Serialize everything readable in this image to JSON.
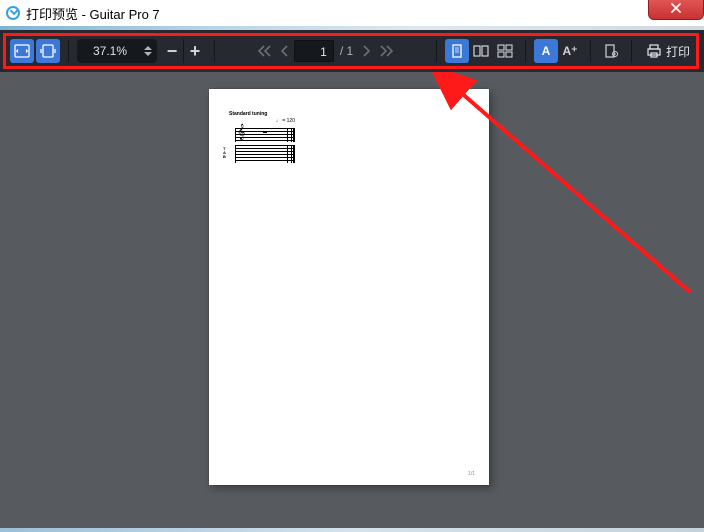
{
  "window": {
    "title": "打印预览 - Guitar Pro 7"
  },
  "toolbar": {
    "zoom_value": "37.1%",
    "minus": "−",
    "plus": "+",
    "page_current": "1",
    "page_separator": "/",
    "page_total": "1",
    "print_label": "打印"
  },
  "icons": {
    "fit_width": "fit-width",
    "fit_page": "fit-page",
    "view_single": "single-page",
    "view_facing": "facing-pages",
    "view_grid": "grid-pages",
    "font_a": "A",
    "font_ap": "A⁺",
    "page_setup": "page-setup",
    "printer": "printer"
  },
  "document": {
    "tuning_label": "Standard tuning",
    "tempo": "= 120",
    "tab_label_1": "T",
    "tab_label_2": "A",
    "tab_label_3": "B",
    "page_number": "1/1"
  }
}
